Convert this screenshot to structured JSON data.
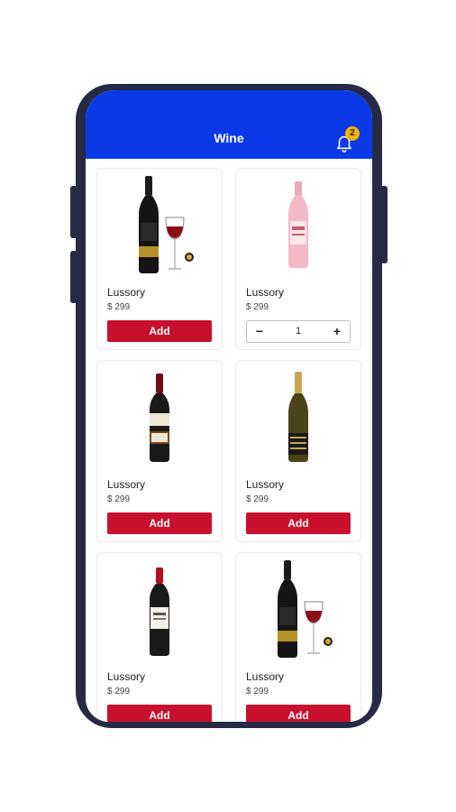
{
  "appbar": {
    "title": "Wine",
    "notification_count": "2",
    "bell_icon": "bell-icon"
  },
  "colors": {
    "appbar": "#0a3ae8",
    "add_button": "#c8102e",
    "badge": "#f5b400",
    "phone_frame": "#262a44"
  },
  "products": [
    {
      "name": "Lussory",
      "price": "$ 299",
      "add_label": "Add",
      "image": "red-wine-bottle-with-glass"
    },
    {
      "name": "Lussory",
      "price": "$ 299",
      "quantity": "1",
      "image": "rose-wine-bottle"
    },
    {
      "name": "Lussory",
      "price": "$ 299",
      "add_label": "Add",
      "image": "red-wine-bottle"
    },
    {
      "name": "Lussory",
      "price": "$ 299",
      "add_label": "Add",
      "image": "sparkling-wine-bottle"
    },
    {
      "name": "Lussory",
      "price": "$ 299",
      "add_label": "Add",
      "image": "red-wine-bottle"
    },
    {
      "name": "Lussory",
      "price": "$ 299",
      "add_label": "Add",
      "image": "red-wine-bottle-with-glass"
    }
  ]
}
